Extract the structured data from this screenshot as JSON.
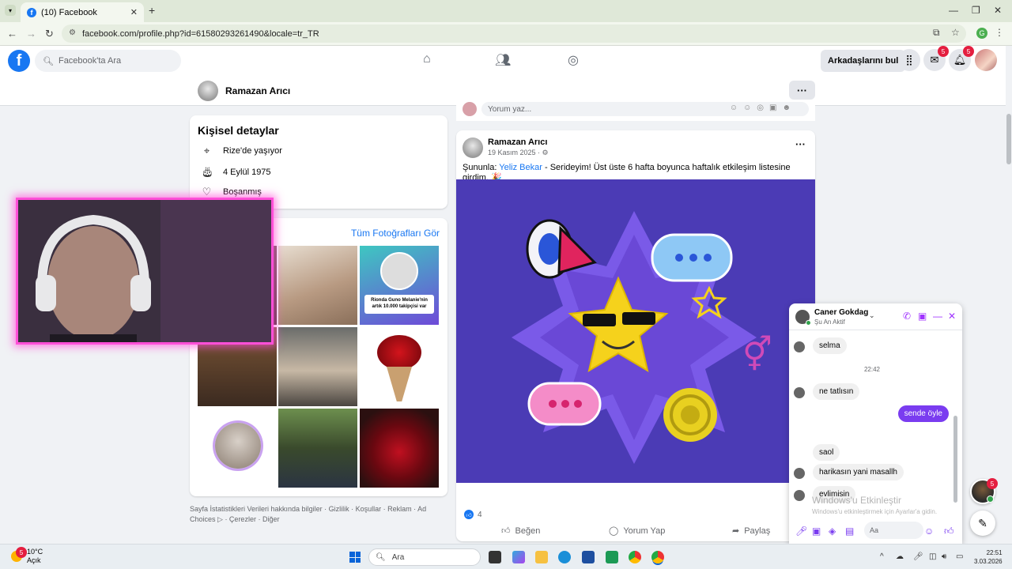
{
  "browser": {
    "tab_title": "(10) Facebook",
    "url": "facebook.com/profile.php?id=61580293261490&locale=tr_TR",
    "profile_initial": "G"
  },
  "facebook": {
    "search_placeholder": "Facebook'ta Ara",
    "find_friends": "Arkadaşlarını bul",
    "messenger_badge": "5",
    "notification_badge": "5"
  },
  "profile": {
    "name": "Ramazan Arıcı",
    "more": "···"
  },
  "details": {
    "title": "Kişisel detaylar",
    "location": "Rize'de yaşıyor",
    "birthday": "4 Eylül 1975",
    "relationship": "Boşanmış"
  },
  "photos": {
    "see_all": "Tüm Fotoğrafları Gör",
    "promo_line1": "Rionda Guno Melanie'nin",
    "promo_line2": "artık 10.000 takipçisi var"
  },
  "footer": {
    "links": "Sayfa İstatistikleri Verileri hakkında bilgiler · Gizlilik · Koşullar · Reklam · Ad Choices ▷ · Çerezler · Diğer"
  },
  "comment_bar": {
    "placeholder": "Yorum yaz..."
  },
  "post": {
    "author": "Ramazan Arıcı",
    "date": "19 Kasım 2025 · ⚙",
    "text_prefix": "Şununla: ",
    "mention": "Yeliz Bekar",
    "text_suffix": " - Serideyim! Üst üste 6 hafta boyunca haftalık etkileşim listesine girdim. 🎉",
    "like_count": "4",
    "like_label": "Beğen",
    "comment_label": "Yorum Yap",
    "share_label": "Paylaş"
  },
  "chat": {
    "contact": "Caner Gokdag",
    "status": "Şu An Aktif",
    "messages": {
      "m1": "selma",
      "time": "22:42",
      "m2": "ne tatlısın",
      "m3": "sende öyle",
      "m4": "saol",
      "m5": "harikasın yani masallh",
      "m6": "evlimisin"
    },
    "input_placeholder": "Aa"
  },
  "watermark": {
    "line1": "Windows'u Etkinleştir",
    "line2": "Windows'u etkinleştirmek için Ayarlar'a gidin."
  },
  "floating": {
    "badge": "5"
  },
  "taskbar": {
    "temperature": "10°C",
    "condition": "Açık",
    "weather_badge": "5",
    "search": "Ara",
    "time": "22:51",
    "date": "3.03.2026"
  },
  "colors": {
    "facebook_blue": "#1877f2",
    "messenger_purple": "#7a3cf0",
    "post_background": "#4b3bb5",
    "webcam_border": "#ff4fd8"
  }
}
